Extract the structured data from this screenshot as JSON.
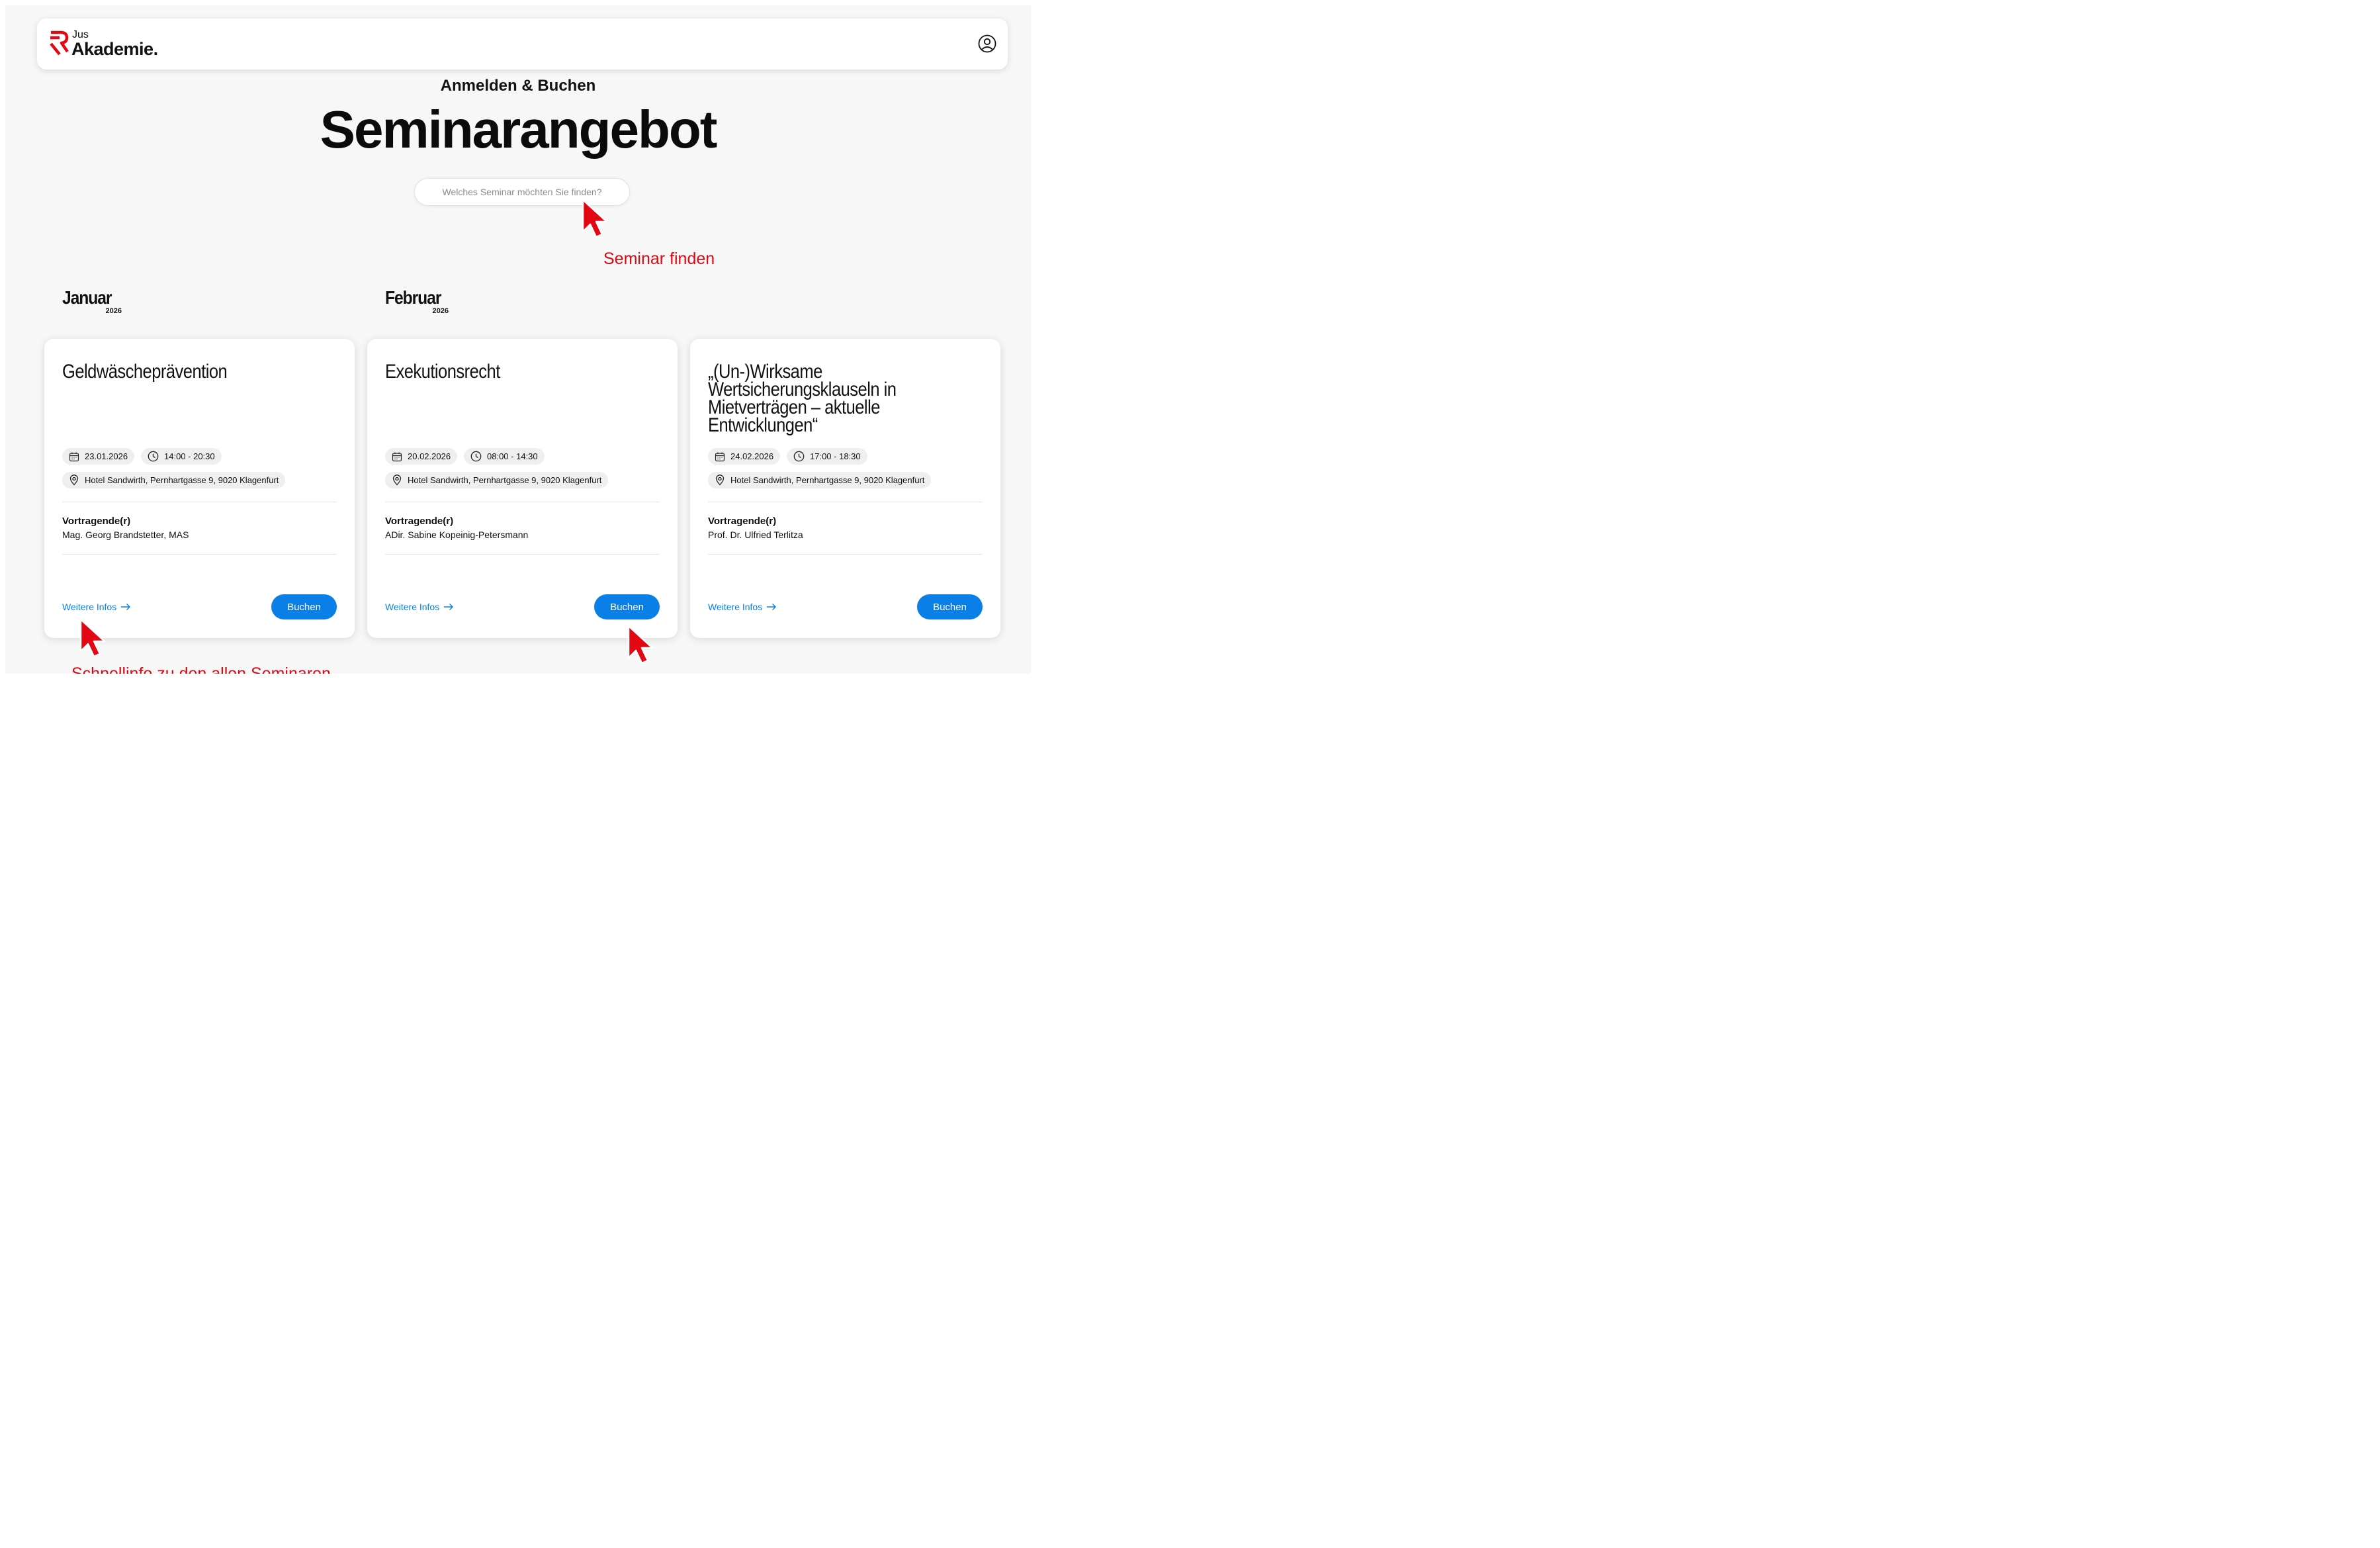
{
  "brand": {
    "logo_small": "Jus",
    "logo_large": "Akademie."
  },
  "hero": {
    "kicker": "Anmelden & Buchen",
    "title": "Seminarangebot"
  },
  "search": {
    "placeholder": "Welches Seminar möchten Sie finden?"
  },
  "annotations": {
    "find": "Seminar finden",
    "bottom_partial": "Schnellinfo zu den allen Seminaren"
  },
  "months": [
    {
      "name": "Januar",
      "year": "2026"
    },
    {
      "name": "Februar",
      "year": "2026"
    }
  ],
  "cards": [
    {
      "title": "Geldwäscheprävention",
      "date": "23.01.2026",
      "time": "14:00 - 20:30",
      "location": "Hotel Sandwirth, Pernhartgasse 9, 9020 Klagenfurt",
      "speaker_label": "Vortragende(r)",
      "speaker": "Mag. Georg Brandstetter, MAS",
      "more_label": "Weitere Infos",
      "book_label": "Buchen"
    },
    {
      "title": "Exekutionsrecht",
      "date": "20.02.2026",
      "time": "08:00 - 14:30",
      "location": "Hotel Sandwirth, Pernhartgasse 9, 9020 Klagenfurt",
      "speaker_label": "Vortragende(r)",
      "speaker": "ADir. Sabine Kopeinig-Petersmann",
      "more_label": "Weitere Infos",
      "book_label": "Buchen"
    },
    {
      "title": "„(Un-)Wirksame Wertsicherungsklauseln in Mietverträgen – aktuelle Entwicklungen“",
      "date": "24.02.2026",
      "time": "17:00 - 18:30",
      "location": "Hotel Sandwirth, Pernhartgasse 9, 9020 Klagenfurt",
      "speaker_label": "Vortragende(r)",
      "speaker": "Prof. Dr. Ulfried Terlitza",
      "more_label": "Weitere Infos",
      "book_label": "Buchen"
    }
  ],
  "icons": {
    "logo": "jus-akademie-logo",
    "account": "user-circle-icon",
    "date": "calendar-icon",
    "time": "clock-icon",
    "location": "map-pin-icon",
    "more": "arrow-right-icon",
    "pointer": "mouse-pointer-icon"
  },
  "colors": {
    "brand_red": "#e30613",
    "annotation_red": "#d60a14",
    "primary_blue": "#0a7fe8",
    "link_blue": "#0a7fe0",
    "page_bg": "#f7f7f7"
  }
}
